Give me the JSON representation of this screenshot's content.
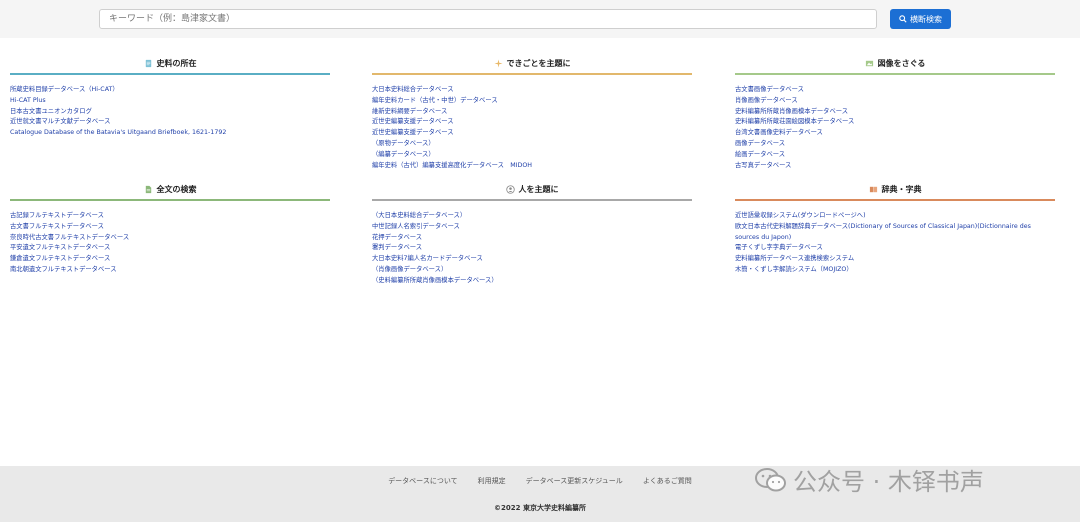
{
  "search": {
    "placeholder": "キーワード（例：島津家文書）",
    "button_label": "横断検索"
  },
  "sections": {
    "location": {
      "title": "史料の所在",
      "accent": "#5aaec4",
      "items": [
        "所蔵史料目録データベース（Hi-CAT）",
        "Hi-CAT Plus",
        "日本古文書ユニオンカタログ",
        "近世就文書マルチ文献データベース",
        "Catalogue Database of the Batavia's Uitgaand Briefboek, 1621-1792"
      ]
    },
    "events": {
      "title": "できごとを主題に",
      "accent": "#e2b86c",
      "items": [
        "大日本史料総合データベース",
        "編年史料カード（古代・中世）データベース",
        "維新史料綱要データベース",
        "近世史編纂支援データベース",
        "近世史編纂支援データベース",
        "（原物データベース）",
        "（編纂データベース）",
        "編年史料（古代）編纂支援高度化データベース　MIDOH"
      ]
    },
    "images": {
      "title": "図像をさぐる",
      "accent": "#a5c98a",
      "items": [
        "古文書画像データベース",
        "肖像画像データベース",
        "史料編纂所所蔵肖像画模本データベース",
        "史料編纂所所蔵荘園絵図模本データベース",
        "台湾文書画像史料データベース",
        "画像データベース",
        "絵画データベース",
        "古写真データベース"
      ]
    },
    "fulltext": {
      "title": "全文の検索",
      "accent": "#8cb87a",
      "items": [
        "古記録フルテキストデータベース",
        "古文書フルテキストデータベース",
        "奈良時代古文書フルテキストデータベース",
        "平安遺文フルテキストデータベース",
        "鎌倉遺文フルテキストデータベース",
        "南北朝遺文フルテキストデータベース"
      ]
    },
    "people": {
      "title": "人を主題に",
      "accent": "#a8a8a8",
      "items": [
        "（大日本史料総合データベース）",
        "中世記録人名索引データベース",
        "花押データベース",
        "署判データベース",
        "大日本史料7編人名カードデータベース",
        "（肖像画像データベース）",
        "（史料編纂所所蔵肖像画模本データベース）"
      ]
    },
    "dictionary": {
      "title": "辞典・字典",
      "accent": "#d98a5c",
      "items": [
        "近世語彙収録システム(ダウンロードページへ)",
        "欧文日本古代史料解題辞典データベース(Dictionary of Sources of Classical Japan)(Dictionnaire des sources du Japon)",
        "電子くずし字字典データベース",
        "史料編纂所データベース連携検索システム",
        "木簡・くずし字解読システム（MOJIZO）"
      ]
    }
  },
  "footer": {
    "links": [
      "データベースについて",
      "利用規定",
      "データベース更新スケジュール",
      "よくあるご質問"
    ],
    "copyright": "©2022 東京大学史料編纂所"
  },
  "watermark": {
    "text": "公众号 · 木铎书声"
  }
}
